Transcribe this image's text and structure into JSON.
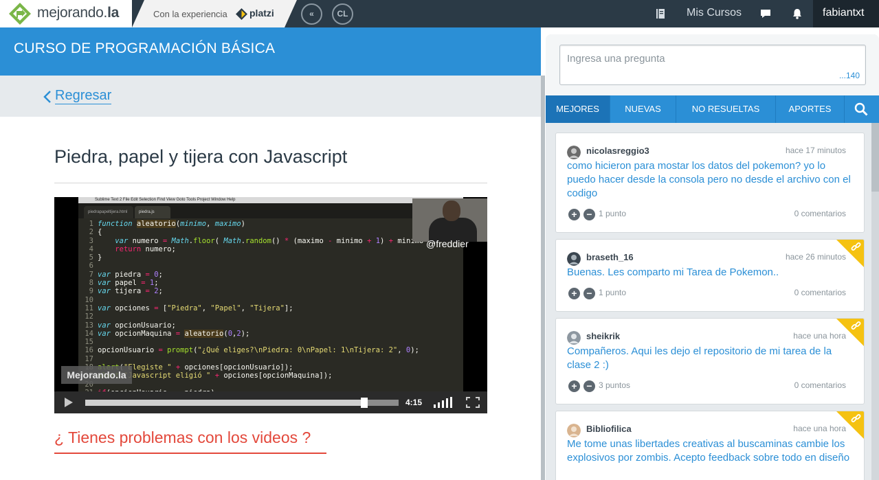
{
  "header": {
    "logo_text": "mejorando.",
    "logo_text_bold": "la",
    "experience_text": "Con la experiencia",
    "platzi": "platzi",
    "cl_label": "CL",
    "mis_cursos": "Mis Cursos",
    "username": "fabiantxt"
  },
  "course": {
    "title": "CURSO DE PROGRAMACIÓN BÁSICA",
    "back_label": "Regresar",
    "lesson_title": "Piedra, papel y tijera con Javascript",
    "problems_link": "¿ Tienes problemas con los videos ?"
  },
  "video": {
    "time": "4:15",
    "progress": 0.89,
    "watermark": "Mejorando.la",
    "overlay_handle": "@freddier",
    "menubar": "Sublime Text 2   File   Edit   Selection   Find   View   Goto   Tools   Project   Window   Help",
    "tab1": "piedrapapeltijera.html",
    "tab2": "piedra.js"
  },
  "questions_panel": {
    "placeholder": "Ingresa una pregunta",
    "char_count": "...140",
    "tabs": [
      "MEJORES",
      "NUEVAS",
      "NO RESUELTAS",
      "APORTES"
    ],
    "items": [
      {
        "user": "nicolasreggio3",
        "time": "hace 17 minutos",
        "text": "como hicieron para mostar los datos del pokemon? yo lo puedo hacer desde la consola pero no desde el archivo con el codigo",
        "points": "1 punto",
        "comments": "0 comentarios",
        "flagged": false
      },
      {
        "user": "braseth_16",
        "time": "hace 26 minutos",
        "text": "Buenas. Les comparto mi Tarea de Pokemon..",
        "points": "1 punto",
        "comments": "0 comentarios",
        "flagged": true
      },
      {
        "user": "sheikrik",
        "time": "hace una hora",
        "text": "Compañeros. Aqui les dejo el repositorio de mi tarea de la clase 2 :)",
        "points": "3 puntos",
        "comments": "0 comentarios",
        "flagged": true
      },
      {
        "user": "Bibliofilica",
        "time": "hace una hora",
        "text": "Me tome unas libertades creativas al buscaminas cambie los explosivos por zombis. Acepto feedback sobre todo en diseño",
        "flagged": true
      }
    ]
  },
  "colors": {
    "accent_blue": "#2b8fd6",
    "topbar": "#2b3a46",
    "warning_red": "#e3483b",
    "ribbon_yellow": "#f5c211"
  }
}
